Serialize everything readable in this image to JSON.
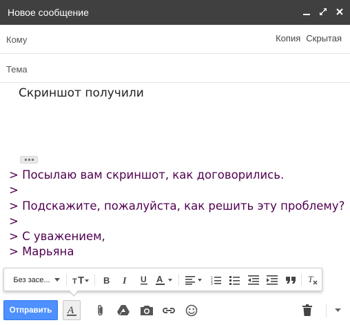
{
  "window": {
    "title": "Новое сообщение",
    "buttons": [
      "minimize-icon",
      "expand-icon",
      "close-icon"
    ]
  },
  "header": {
    "to_label": "Кому",
    "cc_label": "Копия",
    "bcc_label": "Скрытая",
    "subject_label": "Тема"
  },
  "body": {
    "text": "Скриншот получили",
    "quoted_lines": [
      "> Посылаю вам скриншот, как договорились.",
      ">",
      "> Подскажите, пожалуйста, как решить эту проблему?",
      ">",
      "> С уважением,",
      "> Марьяна"
    ]
  },
  "format_toolbar": {
    "font_label": "Без засе...",
    "icons": [
      "font-size-icon",
      "bold-icon",
      "italic-icon",
      "underline-icon",
      "text-color-icon",
      "align-icon",
      "numbered-list-icon",
      "bulleted-list-icon",
      "indent-less-icon",
      "indent-more-icon",
      "quote-icon",
      "remove-formatting-icon"
    ]
  },
  "bottom_bar": {
    "send_label": "Отправить",
    "icons": [
      "formatting-icon",
      "attach-icon",
      "drive-icon",
      "photo-icon",
      "link-icon",
      "emoji-icon",
      "trash-icon",
      "more-options-icon"
    ]
  },
  "colors": {
    "titlebar_bg": "#404040",
    "send_button_bg": "#4d90fe",
    "quote_text": "#500050"
  }
}
